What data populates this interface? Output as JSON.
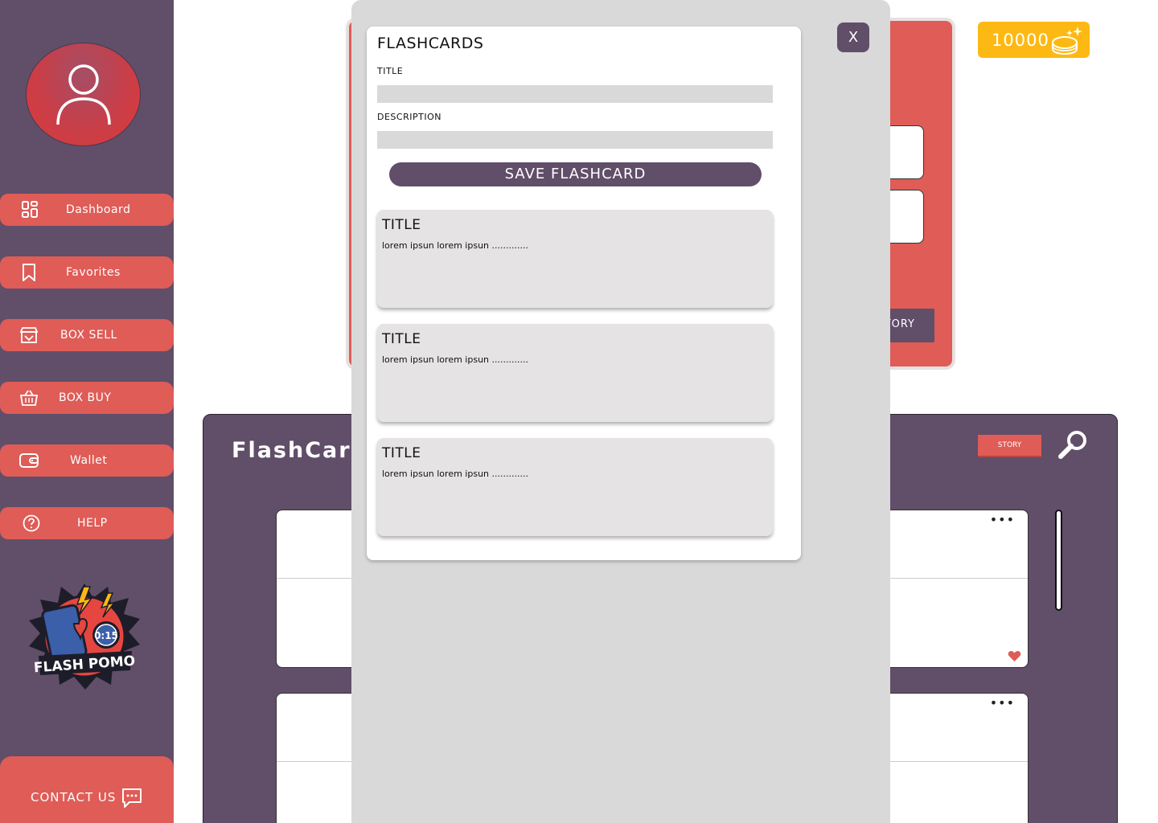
{
  "sidebar": {
    "items": [
      {
        "label": "Dashboard",
        "icon": "dashboard-icon"
      },
      {
        "label": "Favorites",
        "icon": "bookmark-icon"
      },
      {
        "label": "BOX SELL",
        "icon": "store-icon"
      },
      {
        "label": "BOX BUY",
        "icon": "basket-icon"
      },
      {
        "label": "Wallet",
        "icon": "wallet-icon"
      },
      {
        "label": "HELP",
        "icon": "help-icon"
      }
    ],
    "logo": {
      "line1": "0:15",
      "line2": "FLASH POMO"
    },
    "contact_label": "CONTACT US"
  },
  "header": {
    "coins": "10000"
  },
  "background": {
    "story_button": "STORY",
    "panel_title": "FlashCards",
    "story_small": "STORY"
  },
  "modal": {
    "close_label": "X",
    "title": "FLASHCARDS",
    "title_label": "TITLE",
    "title_value": "",
    "description_label": "DESCRIPTION",
    "description_value": "",
    "save_label": "SAVE FLASHCARD",
    "cards": [
      {
        "title": "TITLE",
        "desc": "lorem ipsun lorem ipsun ............."
      },
      {
        "title": "TITLE",
        "desc": "lorem ipsun lorem ipsun ............."
      },
      {
        "title": "TITLE",
        "desc": "lorem ipsun lorem ipsun ............."
      }
    ]
  },
  "colors": {
    "sidebar": "#614e69",
    "accent_red": "#df5c57",
    "coins_yellow": "#fdb913",
    "modal_bg": "#d9d9d9",
    "card_bg": "#e5e3e4"
  }
}
